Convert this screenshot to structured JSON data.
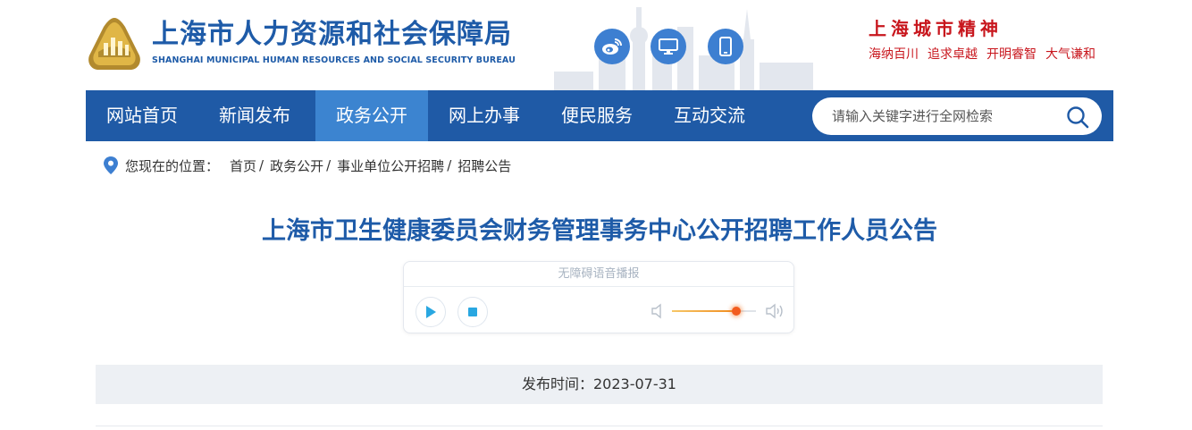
{
  "header": {
    "site_title": "上海市人力资源和社会保障局",
    "site_subtitle": "SHANGHAI MUNICIPAL HUMAN RESOURCES AND SOCIAL SECURITY BUREAU",
    "social_icons": [
      "weibo-icon",
      "monitor-icon",
      "mobile-icon"
    ],
    "spirit_title": "上海城市精神",
    "spirit_slogans": [
      "海纳百川",
      "追求卓越",
      "开明睿智",
      "大气谦和"
    ]
  },
  "nav": {
    "items": [
      {
        "label": "网站首页",
        "active": false
      },
      {
        "label": "新闻发布",
        "active": false
      },
      {
        "label": "政务公开",
        "active": true
      },
      {
        "label": "网上办事",
        "active": false
      },
      {
        "label": "便民服务",
        "active": false
      },
      {
        "label": "互动交流",
        "active": false
      }
    ],
    "search_placeholder": "请输入关键字进行全网检索",
    "search_value": ""
  },
  "breadcrumb": {
    "lead": "您现在的位置：",
    "items": [
      "首页",
      "政务公开",
      "事业单位公开招聘",
      "招聘公告"
    ],
    "separator": "/"
  },
  "article": {
    "title": "上海市卫生健康委员会财务管理事务中心公开招聘工作人员公告",
    "publish_time": "发布时间：2023-07-31"
  },
  "player": {
    "header": "无障碍语音播报",
    "volume_fraction": 0.77
  },
  "colors": {
    "brand_blue": "#1f5aa6",
    "nav_active": "#3c84d0",
    "title_blue": "#1e5ba8",
    "spirit_red": "#c8161d"
  }
}
